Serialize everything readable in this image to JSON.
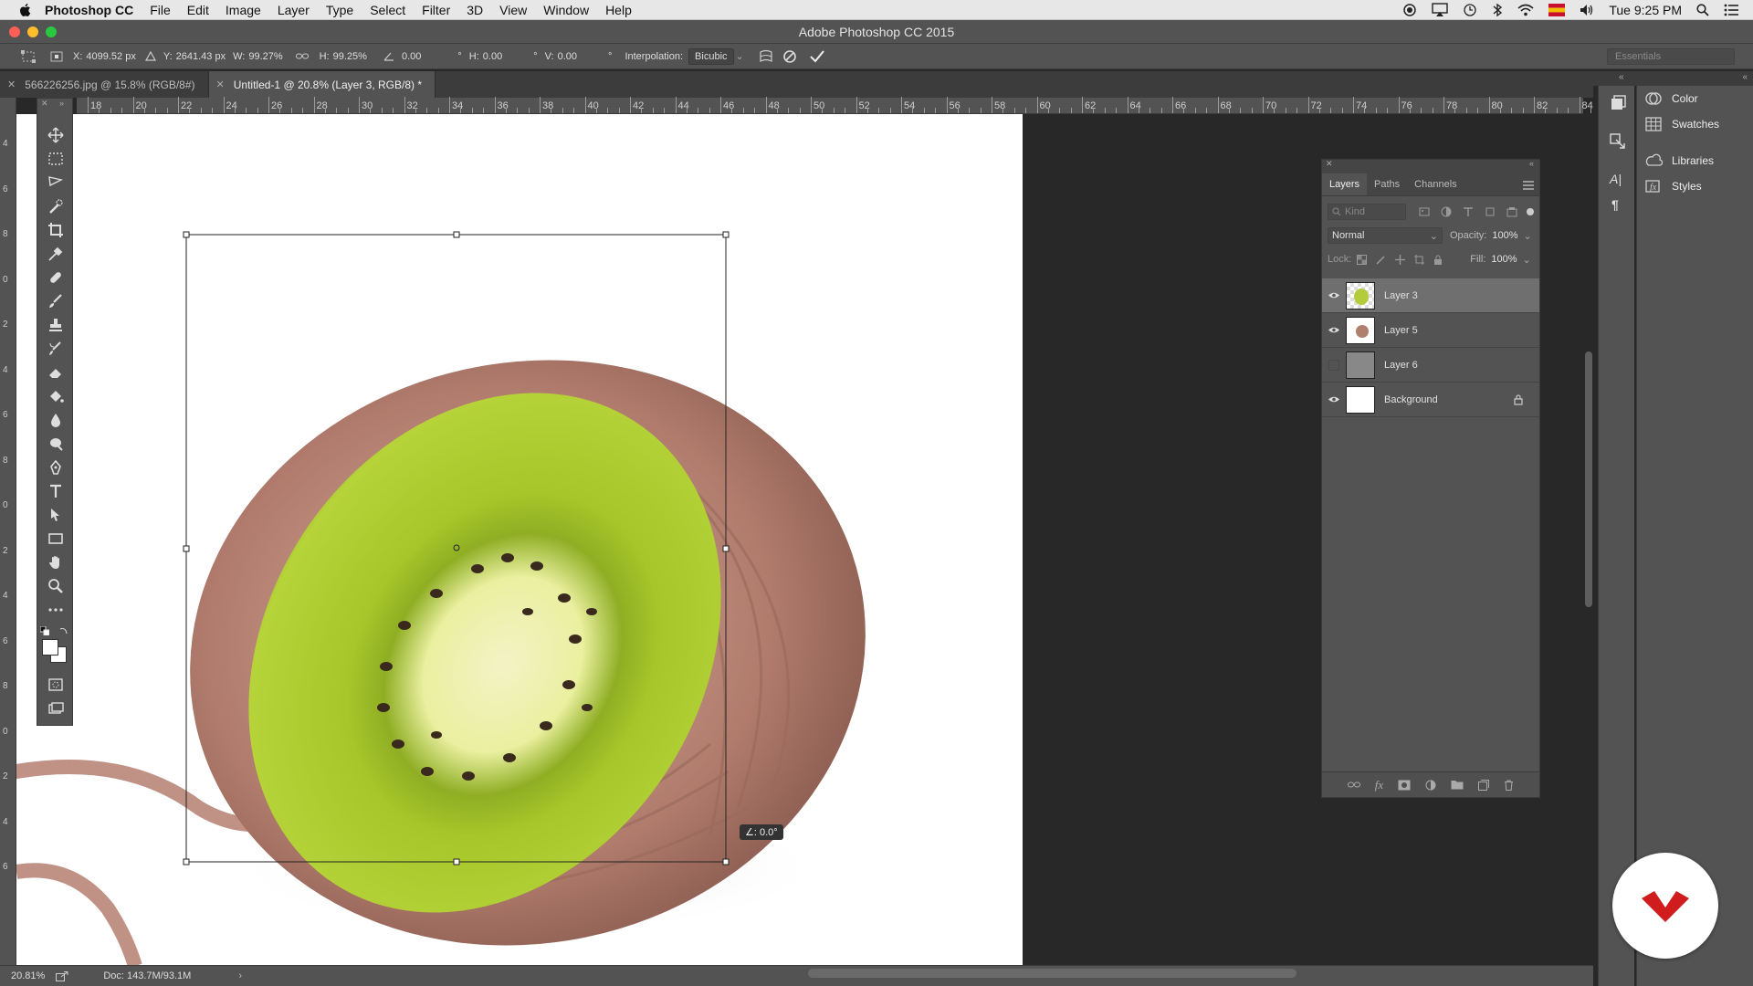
{
  "menubar": {
    "app_name": "Photoshop CC",
    "items": [
      "File",
      "Edit",
      "Image",
      "Layer",
      "Type",
      "Select",
      "Filter",
      "3D",
      "View",
      "Window",
      "Help"
    ],
    "clock": "Tue 9:25 PM"
  },
  "window": {
    "title": "Adobe Photoshop CC 2015"
  },
  "options": {
    "x_label": "X:",
    "x_value": "4099.52 px",
    "y_label": "Y:",
    "y_value": "2641.43 px",
    "w_label": "W:",
    "w_value": "99.27%",
    "h_label": "H:",
    "h_value": "99.25%",
    "angle_value": "0.00",
    "angle_unit": "°",
    "hskew_label": "H:",
    "hskew_value": "0.00",
    "hskew_unit": "°",
    "vskew_label": "V:",
    "vskew_value": "0.00",
    "vskew_unit": "°",
    "interp_label": "Interpolation:",
    "interp_value": "Bicubic",
    "workspace": "Essentials"
  },
  "tabs": [
    {
      "label": "566226256.jpg @ 15.8% (RGB/8#)",
      "active": false
    },
    {
      "label": "Untitled-1 @ 20.8% (Layer 3, RGB/8) *",
      "active": true
    }
  ],
  "ruler": {
    "h_labels": [
      "18",
      "20",
      "22",
      "24",
      "26",
      "28",
      "30",
      "32",
      "34",
      "36",
      "38",
      "40",
      "42",
      "44",
      "46",
      "48",
      "50",
      "52",
      "54",
      "56",
      "58",
      "60",
      "62",
      "64",
      "66",
      "68",
      "70",
      "72",
      "74",
      "76",
      "78",
      "80",
      "82",
      "84"
    ],
    "v_labels": [
      "4",
      "6",
      "8",
      "0",
      "2",
      "4",
      "6",
      "8",
      "0",
      "2",
      "4",
      "6",
      "8",
      "0",
      "2",
      "4",
      "6"
    ]
  },
  "canvas": {
    "rotation_readout": "∠: 0.0°"
  },
  "status": {
    "zoom": "20.81%",
    "doc": "Doc: 143.7M/93.1M"
  },
  "layers_panel": {
    "tabs": [
      "Layers",
      "Paths",
      "Channels"
    ],
    "kind_placeholder": "Kind",
    "blend_mode": "Normal",
    "opacity_label": "Opacity:",
    "opacity_value": "100%",
    "lock_label": "Lock:",
    "fill_label": "Fill:",
    "fill_value": "100%",
    "layers": [
      {
        "name": "Layer 3",
        "visible": true,
        "selected": true
      },
      {
        "name": "Layer 5",
        "visible": true,
        "selected": false
      },
      {
        "name": "Layer 6",
        "visible": false,
        "selected": false
      },
      {
        "name": "Background",
        "visible": true,
        "selected": false,
        "locked": true
      }
    ]
  },
  "dock": {
    "items": [
      "Color",
      "Swatches",
      "Libraries",
      "Styles"
    ]
  },
  "colors": {
    "panel_bg": "#535353",
    "canvas_bg": "#282828",
    "kiwi_green": "#a9c925",
    "yarn": "#b88577",
    "badge_red": "#d01c1c"
  }
}
